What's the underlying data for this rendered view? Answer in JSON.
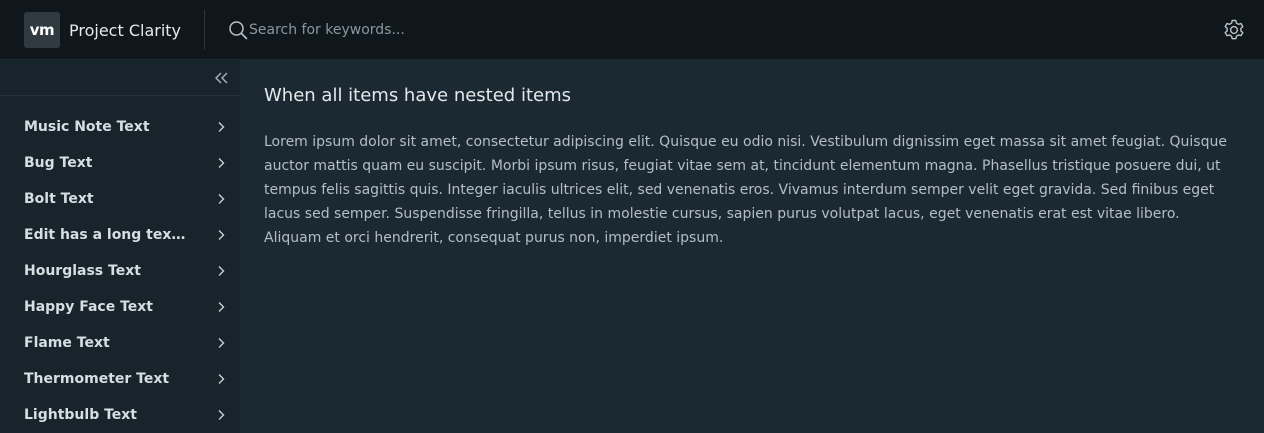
{
  "header": {
    "logo_text": "vm",
    "title": "Project Clarity",
    "search_placeholder": "Search for keywords...",
    "search_value": "",
    "search_icon": "search-icon",
    "settings_icon": "gear-icon"
  },
  "sidebar": {
    "collapse_icon": "double-chevron-left-icon",
    "items": [
      {
        "label": "Music Note Text"
      },
      {
        "label": "Bug Text"
      },
      {
        "label": "Bolt Text"
      },
      {
        "label": "Edit has a long text th..."
      },
      {
        "label": "Hourglass Text"
      },
      {
        "label": "Happy Face Text"
      },
      {
        "label": "Flame Text"
      },
      {
        "label": "Thermometer Text"
      },
      {
        "label": "Lightbulb Text"
      }
    ]
  },
  "main": {
    "title": "When all items have nested items",
    "body": "Lorem ipsum dolor sit amet, consectetur adipiscing elit. Quisque eu odio nisi. Vestibulum dignissim eget massa sit amet feugiat. Quisque auctor mattis quam eu suscipit. Morbi ipsum risus, feugiat vitae sem at, tincidunt elementum magna. Phasellus tristique posuere dui, ut tempus felis sagittis quis. Integer iaculis ultrices elit, sed venenatis eros. Vivamus interdum semper velit eget gravida. Sed finibus eget lacus sed semper. Suspendisse fringilla, tellus in molestie cursus, sapien purus volutpat lacus, eget venenatis erat est vitae libero. Aliquam et orci hendrerit, consequat purus non, imperdiet ipsum."
  },
  "colors": {
    "header_bg": "#0f171c",
    "sidebar_bg": "#17242b",
    "content_bg": "#1b2a32",
    "text_primary": "#e3e8eb",
    "text_secondary": "#b4bec4"
  }
}
